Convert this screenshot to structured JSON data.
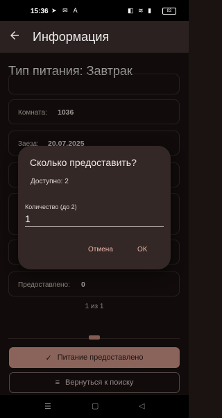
{
  "status_bar": {
    "time": "15:36",
    "battery": "82"
  },
  "app_bar": {
    "title": "Информация"
  },
  "meal_heading": "Тип питания: Завтрак",
  "details": {
    "room_label": "Комната:",
    "room_value": "1036",
    "checkin_label": "Заезд:",
    "checkin_value": "20.07.2025",
    "provided_label": "Предоставлено:",
    "provided_value": "0"
  },
  "pager": {
    "text": "1 из 1"
  },
  "buttons": {
    "meal_provided": "Питание предоставлено",
    "back_to_search": "Вернуться к поиску"
  },
  "dialog": {
    "title": "Сколько предоставить?",
    "available": "Доступно: 2",
    "quantity_label": "Количество (до 2)",
    "quantity_value": "1",
    "cancel": "Отмена",
    "ok": "OK"
  }
}
